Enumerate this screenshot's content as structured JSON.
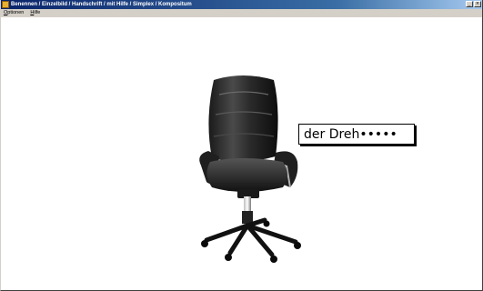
{
  "window": {
    "title": "Benennen / Einzelbild / Handschrift / mit Hilfe / Simplex / Kompositum",
    "buttons": {
      "minimize_glyph": "_",
      "close_glyph": "×"
    }
  },
  "menu": {
    "items": [
      {
        "accel": "O",
        "rest": "ptionen"
      },
      {
        "accel": "H",
        "rest": "ilfe"
      }
    ]
  },
  "exercise": {
    "image": "office-chair",
    "answer_text": "der Dreh•••••"
  },
  "colors": {
    "titlebar_start": "#0a246a",
    "titlebar_end": "#a6caf0",
    "chrome": "#d4d0c8",
    "background": "#ffffff"
  }
}
